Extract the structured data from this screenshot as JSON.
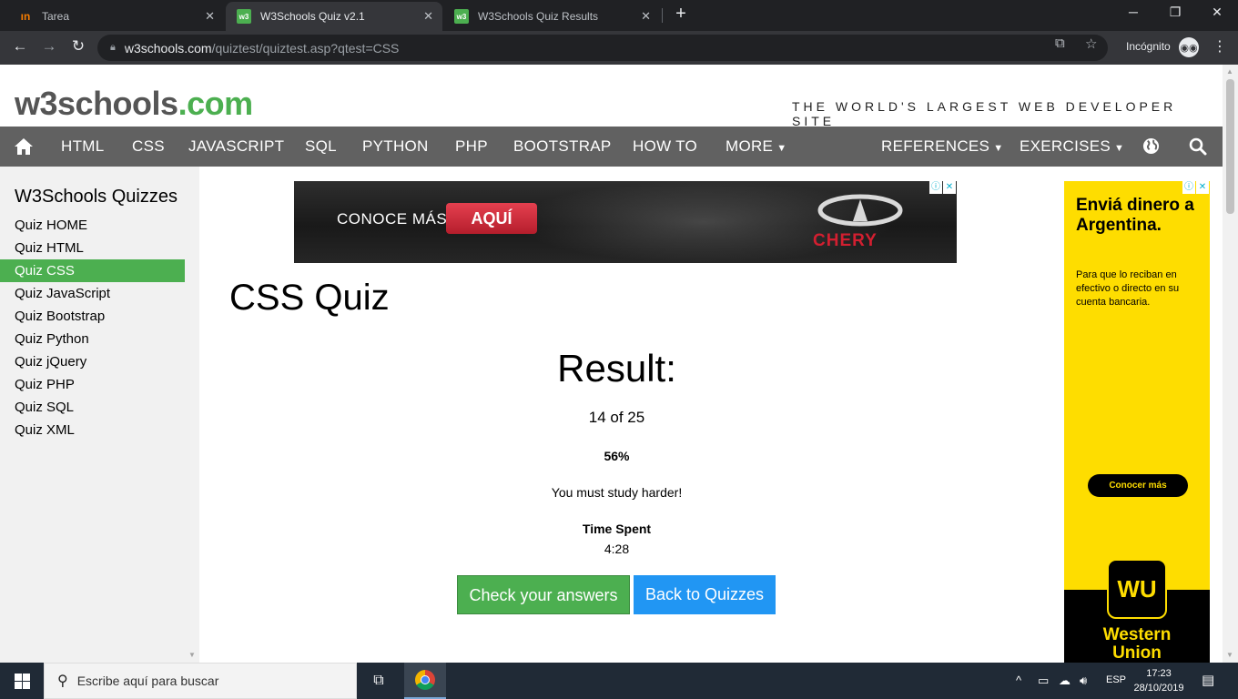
{
  "browser": {
    "tabs": [
      {
        "title": "Tarea",
        "active": false
      },
      {
        "title": "W3Schools Quiz v2.1",
        "active": true
      },
      {
        "title": "W3Schools Quiz Results",
        "active": false
      }
    ],
    "url_host": "w3schools.com",
    "url_path": "/quiztest/quiztest.asp?qtest=CSS",
    "incognito_label": "Incógnito"
  },
  "site": {
    "logo_main": "w3schools",
    "logo_suffix": ".com",
    "tagline": "THE WORLD'S LARGEST WEB DEVELOPER SITE",
    "nav": [
      "HTML",
      "CSS",
      "JAVASCRIPT",
      "SQL",
      "PYTHON",
      "PHP",
      "BOOTSTRAP",
      "HOW TO",
      "MORE",
      "REFERENCES",
      "EXERCISES"
    ]
  },
  "sidebar": {
    "title": "W3Schools Quizzes",
    "items": [
      "Quiz HOME",
      "Quiz HTML",
      "Quiz CSS",
      "Quiz JavaScript",
      "Quiz Bootstrap",
      "Quiz Python",
      "Quiz jQuery",
      "Quiz PHP",
      "Quiz SQL",
      "Quiz XML"
    ],
    "active_item": "Quiz CSS"
  },
  "ad_banner": {
    "text": "CONOCE MÁS",
    "button": "AQUÍ",
    "brand": "CHERY"
  },
  "quiz": {
    "title": "CSS Quiz",
    "result_heading": "Result:",
    "score": "14 of 25",
    "percent": "56%",
    "message": "You must study harder!",
    "time_label": "Time Spent",
    "time_value": "4:28",
    "check_button": "Check your answers",
    "back_button": "Back to Quizzes"
  },
  "ad_side": {
    "headline": "Enviá dinero a Argentina.",
    "body": "Para que lo reciban en efectivo o directo en su cuenta bancaria.",
    "cta": "Conocer más",
    "logo": "WU",
    "brand_line1": "Western",
    "brand_line2": "Union"
  },
  "taskbar": {
    "search_placeholder": "Escribe aquí para buscar",
    "language": "ESP",
    "time": "17:23",
    "date": "28/10/2019"
  },
  "colors": {
    "w3_green": "#4caf50",
    "nav_gray": "#616161",
    "button_blue": "#2196f3",
    "wu_yellow": "#fedd00"
  }
}
